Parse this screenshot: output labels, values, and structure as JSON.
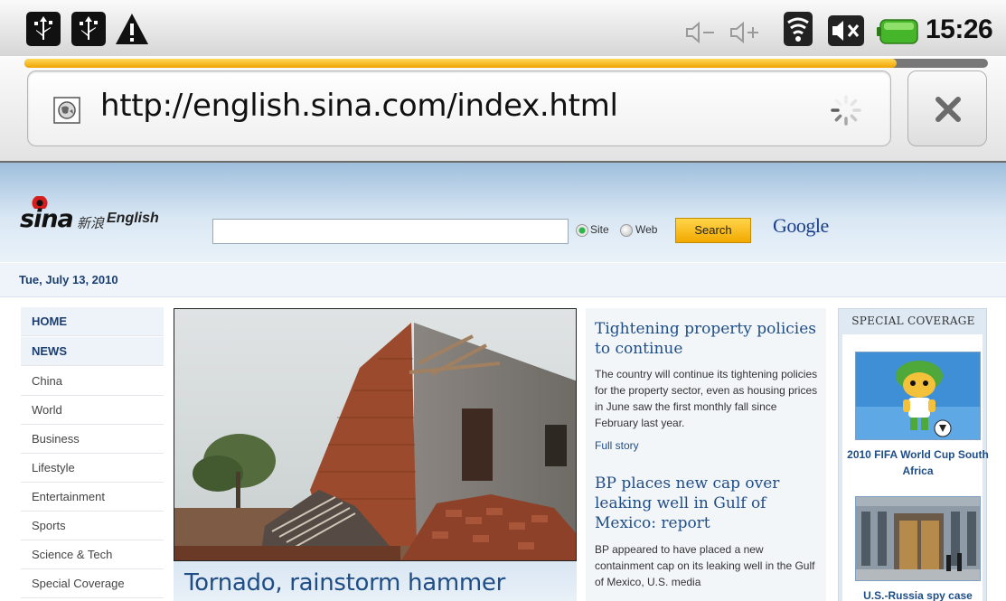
{
  "status_bar": {
    "icons": [
      "usb-icon",
      "usb-icon",
      "warning-icon",
      "volume-down-icon",
      "volume-up-icon",
      "wifi-icon",
      "mute-icon",
      "battery-icon"
    ],
    "time": "15:26"
  },
  "browser": {
    "url": "http://english.sina.com/index.html",
    "load_progress": 0.905,
    "stop_icon": "close-icon"
  },
  "site": {
    "logo": {
      "mark": "sina",
      "chinese": "新浪",
      "english": "English"
    },
    "search": {
      "placeholder": "",
      "options": [
        "Site",
        "Web"
      ],
      "selected": "Site",
      "button_label": "Search",
      "provider": "Google"
    },
    "date": "Tue, July 13, 2010",
    "nav": [
      {
        "label": "HOME",
        "strong": true
      },
      {
        "label": "NEWS",
        "strong": true
      },
      {
        "label": "China"
      },
      {
        "label": "World"
      },
      {
        "label": "Business"
      },
      {
        "label": "Lifestyle"
      },
      {
        "label": "Entertainment"
      },
      {
        "label": "Sports"
      },
      {
        "label": "Science & Tech"
      },
      {
        "label": "Special Coverage"
      }
    ],
    "main_story": {
      "caption": "Tornado, rainstorm hammer"
    },
    "news": [
      {
        "headline": "Tightening property policies to continue",
        "summary": "The country will continue its tightening policies for the property sector, even as housing prices in June saw the first monthly fall since February last year.",
        "link": "Full story"
      },
      {
        "headline": "BP places new cap over leaking well in Gulf of Mexico: report",
        "summary": "BP appeared to have placed a new containment cap on its leaking well in the Gulf of Mexico, U.S. media"
      }
    ],
    "special_coverage": {
      "title": "SPECIAL COVERAGE",
      "items": [
        {
          "label": "2010 FIFA World Cup South Africa"
        },
        {
          "label": "U.S.-Russia spy case"
        }
      ]
    }
  }
}
